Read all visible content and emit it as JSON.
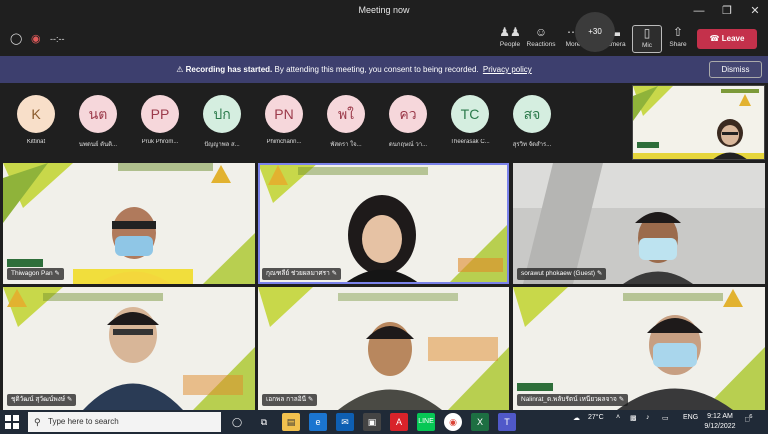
{
  "window": {
    "title": "Meeting now"
  },
  "toolbar": {
    "timer": "--:--",
    "people": "People",
    "reactions": "Reactions",
    "more": "More",
    "camera": "Camera",
    "mic": "Mic",
    "share": "Share",
    "leave": "Leave"
  },
  "banner": {
    "strong": "Recording has started.",
    "text": "By attending this meeting, you consent to being recorded.",
    "link": "Privacy policy",
    "dismiss": "Dismiss"
  },
  "avatars": [
    {
      "initials": "K",
      "name": "Kittinat",
      "bg": "#f8dfc9",
      "fg": "#8a5a2b"
    },
    {
      "initials": "นต",
      "name": "นพดนย์ ตันติ...",
      "bg": "#f6d7db",
      "fg": "#9c3b4b"
    },
    {
      "initials": "PP",
      "name": "Pruk Phrom...",
      "bg": "#f6d7db",
      "fg": "#9c3b4b"
    },
    {
      "initials": "ปก",
      "name": "ปัญญาพล ส...",
      "bg": "#d5eee0",
      "fg": "#2b7a4b"
    },
    {
      "initials": "PN",
      "name": "Phimchann...",
      "bg": "#f6d7db",
      "fg": "#9c3b4b"
    },
    {
      "initials": "พใ",
      "name": "พัสตรา ใจ...",
      "bg": "#f6d7db",
      "fg": "#9c3b4b"
    },
    {
      "initials": "คว",
      "name": "ดนกฤษณ์ วา...",
      "bg": "#f6d7db",
      "fg": "#9c3b4b"
    },
    {
      "initials": "TC",
      "name": "Theerasak C...",
      "bg": "#d5eee0",
      "fg": "#2b7a4b"
    },
    {
      "initials": "สจ",
      "name": "สุรวิท จัดสำร...",
      "bg": "#d5eee0",
      "fg": "#2b7a4b"
    }
  ],
  "more_count": "+30",
  "tiles": [
    {
      "name": "Thiwagon Pan"
    },
    {
      "name": "กุณฑลีย์ ช่วยผลมาศรา"
    },
    {
      "name": "sorawut phokaew (Guest)"
    },
    {
      "name": "ชุติวัฒน์ สุวัฒน์พงษ์"
    },
    {
      "name": "เอกพล กาลอินี"
    },
    {
      "name": "Nalinrat_ด.พลับรัตน์ เหนียวผลจาจ"
    }
  ],
  "taskbar": {
    "search_placeholder": "Type here to search",
    "weather": "27°C",
    "lang": "ENG",
    "time": "9:12 AM",
    "date": "9/12/2022",
    "notif_count": "6"
  }
}
